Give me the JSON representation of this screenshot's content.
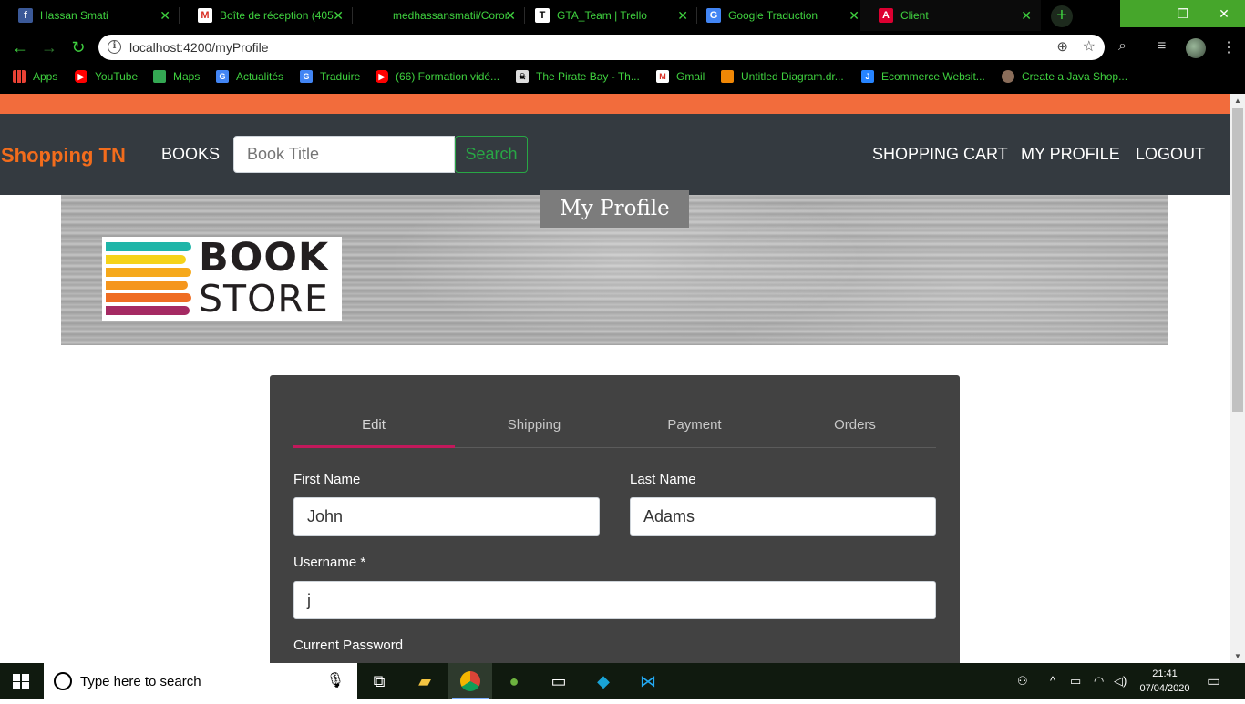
{
  "browser": {
    "tabs": [
      {
        "title": "Hassan Smati",
        "icon": "facebook-icon",
        "color": "#3b5998"
      },
      {
        "title": "Boîte de réception (405",
        "icon": "gmail-icon",
        "color": "#d93025"
      },
      {
        "title": "medhassansmatii/Coron",
        "icon": "github-icon",
        "color": "#000000"
      },
      {
        "title": "GTA_Team | Trello",
        "icon": "trello-icon",
        "color": "#0079bf"
      },
      {
        "title": "Google Traduction",
        "icon": "google-translate-icon",
        "color": "#4285f4"
      },
      {
        "title": "Client",
        "icon": "angular-icon",
        "color": "#dd0031"
      }
    ],
    "url": "localhost:4200/myProfile",
    "bookmarks": [
      {
        "label": "Apps",
        "icon": "apps-grid-icon"
      },
      {
        "label": "YouTube",
        "icon": "youtube-icon"
      },
      {
        "label": "Maps",
        "icon": "maps-icon"
      },
      {
        "label": "Actualités",
        "icon": "google-news-icon"
      },
      {
        "label": "Traduire",
        "icon": "google-translate-icon"
      },
      {
        "label": "(66) Formation vidé...",
        "icon": "youtube-icon"
      },
      {
        "label": "The Pirate Bay - Th...",
        "icon": "pirate-bay-icon"
      },
      {
        "label": "Gmail",
        "icon": "gmail-icon"
      },
      {
        "label": "Untitled Diagram.dr...",
        "icon": "drawio-icon"
      },
      {
        "label": "Ecommerce Websit...",
        "icon": "jira-icon"
      },
      {
        "label": "Create a Java Shop...",
        "icon": "site-icon"
      }
    ]
  },
  "navbar": {
    "brand": "Shopping TN",
    "books": "BOOKS",
    "search_placeholder": "Book Title",
    "search_button": "Search",
    "shopping_cart": "SHOPPING CART",
    "my_profile": "MY PROFILE",
    "logout": "LOGOUT"
  },
  "banner": {
    "title": "My Profile",
    "logo_line1": "BOOK",
    "logo_line2": "STORE"
  },
  "profile": {
    "tabs": [
      "Edit",
      "Shipping",
      "Payment",
      "Orders"
    ],
    "active_tab": "Edit",
    "fields": {
      "first_name_label": "First Name",
      "first_name_value": "John",
      "last_name_label": "Last Name",
      "last_name_value": "Adams",
      "username_label": "Username *",
      "username_value": "j",
      "current_password_label": "Current Password"
    }
  },
  "taskbar": {
    "search_placeholder": "Type here to search",
    "time": "21:41",
    "date": "07/04/2020"
  },
  "colors": {
    "accent_orange": "#f26c3c",
    "brand_orange": "#f26c1c",
    "navbar_bg": "#343a40",
    "search_green": "#28a745",
    "tab_ink": "#c2185b",
    "card_bg": "#424242",
    "chrome_green": "#3fd13f"
  }
}
